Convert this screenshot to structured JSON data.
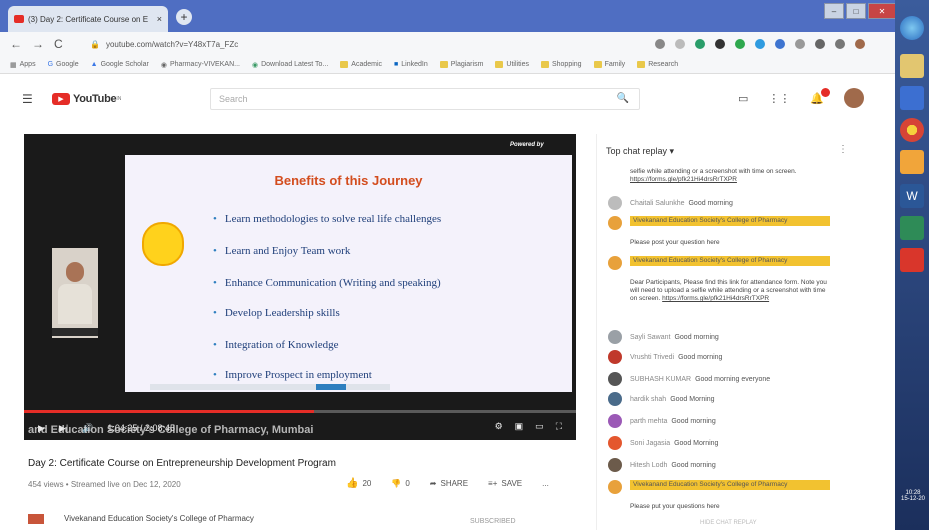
{
  "browser": {
    "tab_title": "(3) Day 2: Certificate Course on E",
    "tab_close": "×",
    "new_tab": "+",
    "url": "youtube.com/watch?v=Y48xT7a_FZc",
    "nav": {
      "back": "←",
      "forward": "→",
      "reload": "C",
      "lock": "🔒"
    },
    "window_buttons": [
      "–",
      "□",
      "✕"
    ],
    "bookmarks": [
      "Apps",
      "Google",
      "Google Scholar",
      "Pharmacy-VIVEKAN...",
      "Download Latest To...",
      "Academic",
      "LinkedIn",
      "Plagiarism",
      "Utilities",
      "Shopping",
      "Family",
      "Research"
    ]
  },
  "youtube": {
    "logo_text": "YouTube",
    "logo_region": "IN",
    "search_placeholder": "Search"
  },
  "video": {
    "powered_by": "Powered by",
    "slide_title": "Benefits of this Journey",
    "bullets": [
      "Learn methodologies to solve real life challenges",
      "Learn and Enjoy Team work",
      "Enhance Communication (Writing and speaking)",
      "Develop Leadership skills",
      "Integration of Knowledge",
      "Improve Prospect in employment"
    ],
    "watermark": "and Education Society's College of Pharmacy, Mumbai",
    "time": "1:04:25 / 2:08:45",
    "title": "Day 2: Certificate Course on Entrepreneurship Development Program",
    "meta": "454 views • Streamed live on Dec 12, 2020",
    "likes": "20",
    "dislikes": "0",
    "share": "SHARE",
    "save": "SAVE",
    "more": "...",
    "channel": "Vivekanand Education Society's College of Pharmacy",
    "subscribed": "SUBSCRIBED"
  },
  "chat": {
    "header": "Top chat replay ▾",
    "messages": [
      {
        "author": "Chaitali Salunkhe",
        "text": "Good morning"
      },
      {
        "author": "Sayli Sawant",
        "text": "Good morning"
      },
      {
        "author": "Vrushti Trivedi",
        "text": "Good morning"
      },
      {
        "author": "SUBHASH KUMAR",
        "text": "Good morning everyone"
      },
      {
        "author": "hardik shah",
        "text": "Good Morning"
      },
      {
        "author": "parth mehta",
        "text": "Good morning"
      },
      {
        "author": "Soni Jagasia",
        "text": "Good Morning"
      },
      {
        "author": "Hitesh Lodh",
        "text": "Good morning"
      }
    ],
    "top_text": "selfie while attending or a screenshot with time on screen.",
    "top_link": "https://forms.gle/pfk21Hi4drsRrTXPR",
    "hl_org": "Vivekanand Education Society's College of Pharmacy",
    "post_question": "Please post your question here",
    "attendance_text": "Dear Participants, Please find this link for attendance form. Note you will need to upload a selfie while attending or a screenshot with time on screen.",
    "final_text": "Please put your questions here",
    "hide_chat": "HIDE CHAT REPLAY"
  },
  "taskbar": {
    "clock_time": "10:28",
    "clock_date": "15-12-20"
  }
}
